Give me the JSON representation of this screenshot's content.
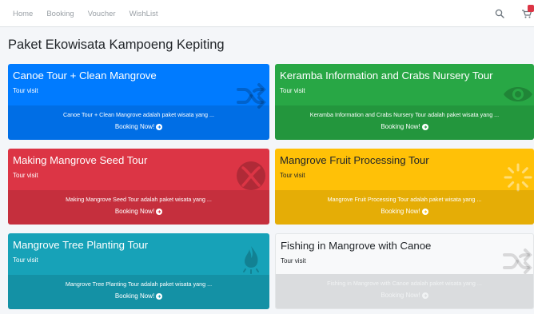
{
  "nav": {
    "links": [
      "Home",
      "Booking",
      "Voucher",
      "WishList"
    ],
    "search_icon": "search-icon",
    "cart_icon": "cart-icon"
  },
  "page": {
    "title": "Paket Ekowisata Kampoeng Kepiting"
  },
  "cards": [
    {
      "title": "Canoe Tour + Clean Mangrove",
      "subtitle": "Tour visit",
      "description": "Canoe Tour + Clean Mangrove adalah paket wisata yang ...",
      "cta": "Booking Now!",
      "icon": "shuffle-icon",
      "color": "#007bff"
    },
    {
      "title": "Keramba Information and Crabs Nursery Tour",
      "subtitle": "Tour visit",
      "description": "Keramba Information and Crabs Nursery Tour adalah paket wisata yang ...",
      "cta": "Booking Now!",
      "icon": "eye-icon",
      "color": "#28a745"
    },
    {
      "title": "Making Mangrove Seed Tour",
      "subtitle": "Tour visit",
      "description": "Making Mangrove Seed Tour adalah paket wisata yang ...",
      "cta": "Booking Now!",
      "icon": "xbox-icon",
      "color": "#dc3545"
    },
    {
      "title": "Mangrove Fruit Processing Tour",
      "subtitle": "Tour visit",
      "description": "Mangrove Fruit Processing Tour adalah paket wisata yang ...",
      "cta": "Booking Now!",
      "icon": "spinner-icon",
      "color": "#ffc107"
    },
    {
      "title": "Mangrove Tree Planting Tour",
      "subtitle": "Tour visit",
      "description": "Mangrove Tree Planting Tour adalah paket wisata yang ...",
      "cta": "Booking Now!",
      "icon": "fire-icon",
      "color": "#17a2b8"
    },
    {
      "title": "Fishing in Mangrove with Canoe",
      "subtitle": "Tour visit",
      "description": "Fishing in Mangrove with Canoe adalah paket wisata yang ...",
      "cta": "Booking Now!",
      "icon": "shuffle-icon",
      "color": "#f8f9fa"
    }
  ]
}
